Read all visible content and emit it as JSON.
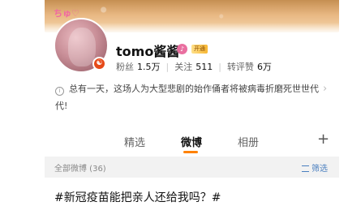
{
  "profile": {
    "sticker_text": "ちゅ♡",
    "avatar_badge": "☯",
    "username": "tomo酱酱",
    "vip_label": "开通",
    "stats": {
      "fans_label": "粉丝",
      "fans_value": "1.5万",
      "following_label": "关注",
      "following_value": "511",
      "likes_label": "转评赞",
      "likes_value": "6万"
    },
    "bio": "总有一天，这场人为大型悲剧的始作俑者将被病毒折磨死世世代代!"
  },
  "tabs": [
    {
      "label": "精选"
    },
    {
      "label": "微博"
    },
    {
      "label": "相册"
    }
  ],
  "feed": {
    "all_posts_label": "全部微博 (36)",
    "filter_label": "筛选",
    "first_post": "#新冠疫苗能把亲人还给我吗？#"
  },
  "colors": {
    "accent": "#ff8200",
    "filter_link": "#4a7fbf",
    "pink": "#e96fa0"
  }
}
